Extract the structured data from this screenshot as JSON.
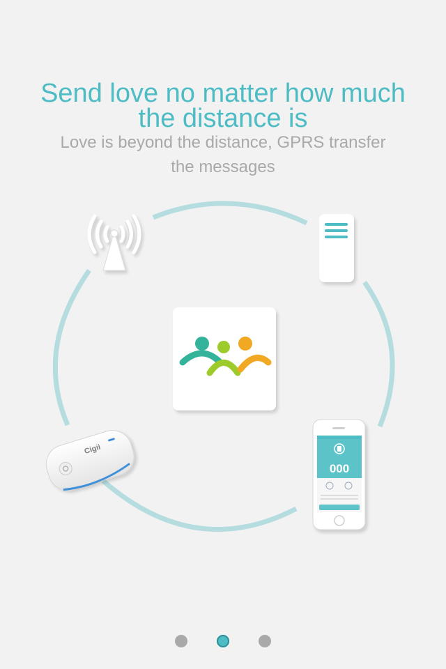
{
  "headline": {
    "line1": "Send love no matter how much",
    "line2": "the distance is"
  },
  "subheadline": {
    "line1": "Love is beyond the distance, GPRS transfer",
    "line2": "the messages"
  },
  "diagram": {
    "device_brand": "Cigii",
    "phone_counter": "000"
  },
  "pager": {
    "total": 3,
    "active_index": 1
  },
  "colors": {
    "background": "#f2f2f2",
    "accent": "#4dbcc4",
    "ring": "#b5dde0",
    "gray_text": "#a9a9a9",
    "logo_teal": "#33b39a",
    "logo_green": "#9ecb2c",
    "logo_orange": "#f1a822"
  }
}
